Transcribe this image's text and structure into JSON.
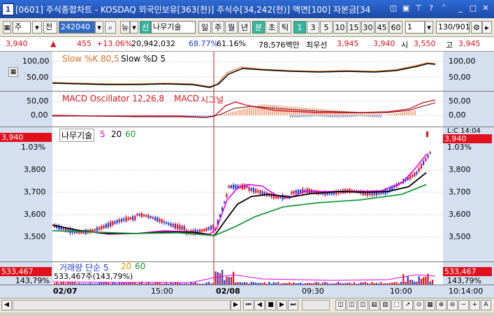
{
  "window": {
    "number": "1",
    "title": "[0601] 주식종합차트 - KOSDAQ 외국인보유[363(천)] 주식수[34,242(천)] 액면[100] 자본금[34"
  },
  "toolbar": {
    "market": "주",
    "jeon": "전",
    "code": "242040",
    "news": "뉴",
    "sin": "신",
    "stock_name": "나무기술",
    "periods": [
      "일",
      "주",
      "월",
      "년",
      "분",
      "초",
      "틱"
    ],
    "minutes": [
      "1",
      "3",
      "5",
      "10",
      "15",
      "30",
      "45",
      "60"
    ],
    "unit_value": "1",
    "count": "130/901"
  },
  "info": {
    "price": "3,940",
    "arrow": "▲",
    "change": "455",
    "change_pct": "+13.06%",
    "volume": "20,942,032",
    "ratio1": "68.77%",
    "ratio2": "61.16%",
    "amount": "78,576백만",
    "best_label": "최우선",
    "best1": "3,945",
    "best2": "3,940",
    "open_label": "시",
    "open": "3,550",
    "high_label": "고",
    "high": "3,945"
  },
  "stoch": {
    "legend_k": "Slow %K 80,5",
    "legend_d": "Slow %D 5",
    "ticks": [
      "100,00",
      "50,00"
    ]
  },
  "macd": {
    "legend_a": "MACD Oscillator 12,26,8",
    "legend_b": "MACD",
    "legend_c": "시그널",
    "ticks": [
      "50,00",
      "0,00"
    ]
  },
  "price": {
    "legend_name": "나무기술",
    "ma1": "5",
    "ma2": "20",
    "ma3": "60",
    "current": "3,940",
    "current_pct": "1.03%",
    "right_label": "L:C 14:04",
    "ticks": [
      "3,800",
      "3,700",
      "3,600",
      "3,500"
    ]
  },
  "volume": {
    "legend": "거래량 단순 5",
    "ma2": "20",
    "ma3": "60",
    "sub": "533,467주(143,79%)",
    "value": "533,467",
    "pct": "143,79%"
  },
  "timeaxis": {
    "labels": [
      "02/07",
      "15:00",
      "02/08",
      "09:30",
      "10:00"
    ],
    "right": "10:14:00"
  },
  "colors": {
    "up": "#e0101c",
    "down": "#1a3ad8",
    "ma5": "#e000e0",
    "ma20": "#000000",
    "ma60": "#1a9a3a",
    "stoch_k": "#e07020",
    "accent": "#39b39f"
  }
}
